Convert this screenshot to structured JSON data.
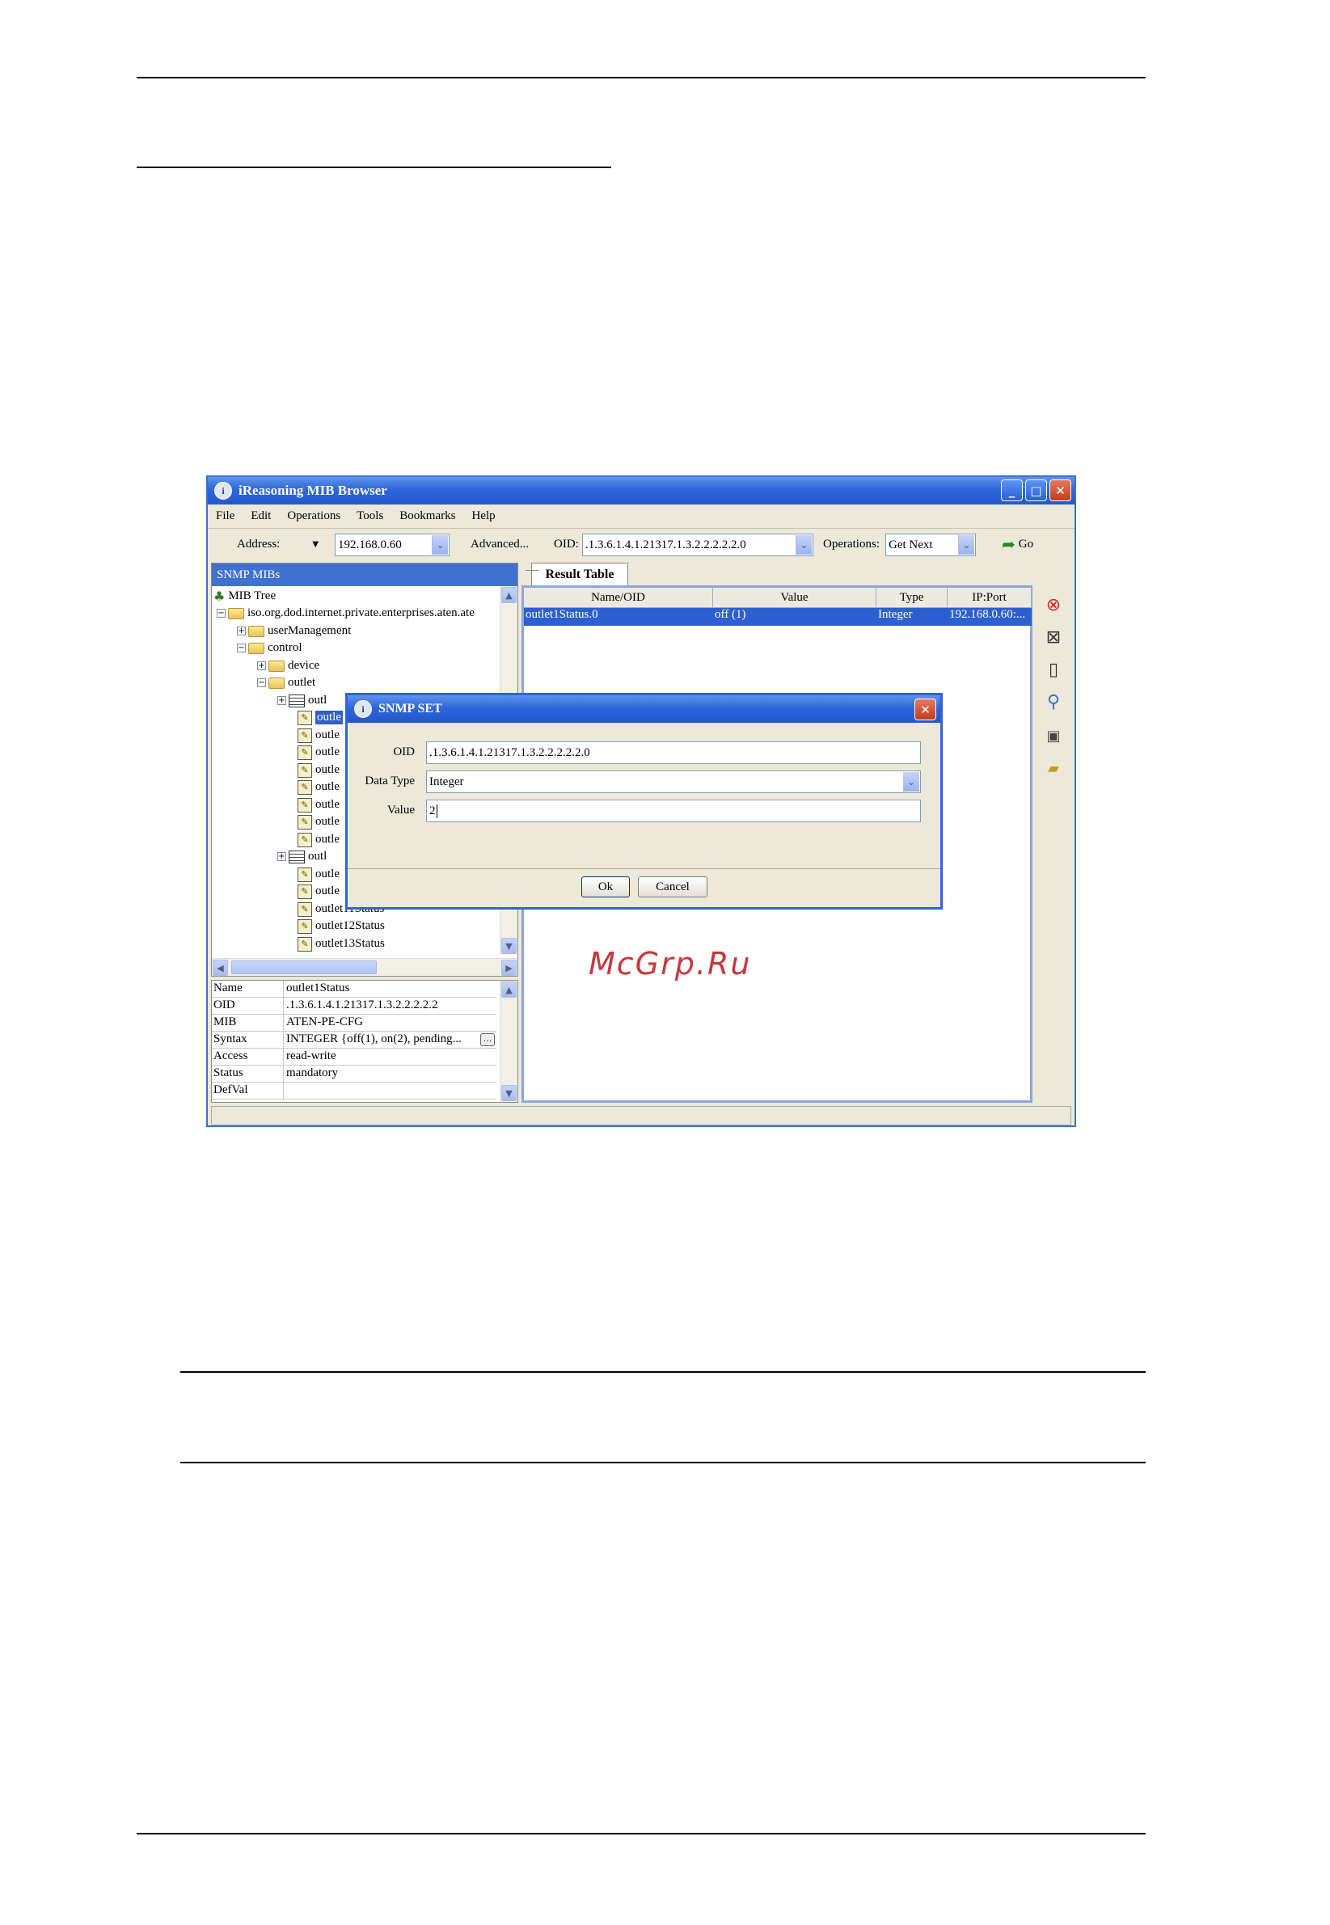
{
  "window": {
    "title": "iReasoning MIB Browser",
    "minimize": "_",
    "maximize": "□",
    "close": "✕"
  },
  "menu": [
    "File",
    "Edit",
    "Operations",
    "Tools",
    "Bookmarks",
    "Help"
  ],
  "toolbar": {
    "address_label": "Address:",
    "address_value": "192.168.0.60",
    "advanced_label": "Advanced...",
    "oid_label": "OID:",
    "oid_value": ".1.3.6.1.4.1.21317.1.3.2.2.2.2.2.0",
    "operations_label": "Operations:",
    "operations_value": "Get Next",
    "go_label": "Go"
  },
  "left_pane": {
    "header": "SNMP MIBs",
    "tree": [
      {
        "label": "MIB Tree",
        "icon": "tree-icon"
      },
      {
        "label": "iso.org.dod.internet.private.enterprises.aten.ate",
        "icon": "folder-icon"
      },
      {
        "label": "userManagement",
        "icon": "folder-icon"
      },
      {
        "label": "control",
        "icon": "folder-icon"
      },
      {
        "label": "device",
        "icon": "folder-icon"
      },
      {
        "label": "outlet",
        "icon": "folder-icon"
      },
      {
        "label": "outl",
        "icon": "table-icon"
      },
      {
        "label": "outle",
        "icon": "leaf-icon"
      },
      {
        "label": "outle",
        "icon": "leaf-icon"
      },
      {
        "label": "outle",
        "icon": "leaf-icon"
      },
      {
        "label": "outle",
        "icon": "leaf-icon"
      },
      {
        "label": "outle",
        "icon": "leaf-icon"
      },
      {
        "label": "outle",
        "icon": "leaf-icon"
      },
      {
        "label": "outle",
        "icon": "leaf-icon"
      },
      {
        "label": "outle",
        "icon": "leaf-icon"
      },
      {
        "label": "outl",
        "icon": "table-icon"
      },
      {
        "label": "outle",
        "icon": "leaf-icon"
      },
      {
        "label": "outle",
        "icon": "leaf-icon"
      },
      {
        "label": "outlet11Status",
        "icon": "leaf-icon"
      },
      {
        "label": "outlet12Status",
        "icon": "leaf-icon"
      },
      {
        "label": "outlet13Status",
        "icon": "leaf-icon"
      }
    ],
    "properties": [
      {
        "key": "Name",
        "value": "outlet1Status"
      },
      {
        "key": "OID",
        "value": ".1.3.6.1.4.1.21317.1.3.2.2.2.2.2"
      },
      {
        "key": "MIB",
        "value": "ATEN-PE-CFG"
      },
      {
        "key": "Syntax",
        "value": "INTEGER {off(1), on(2), pending..."
      },
      {
        "key": "Access",
        "value": "read-write"
      },
      {
        "key": "Status",
        "value": "mandatory"
      },
      {
        "key": "DefVal",
        "value": ""
      }
    ]
  },
  "result_table": {
    "tab": "Result Table",
    "columns": [
      "Name/OID",
      "Value",
      "Type",
      "IP:Port"
    ],
    "rows": [
      [
        "outlet1Status.0",
        "off (1)",
        "Integer",
        "192.168.0.60:..."
      ]
    ]
  },
  "dialog": {
    "title": "SNMP SET",
    "oid_label": "OID",
    "oid_value": ".1.3.6.1.4.1.21317.1.3.2.2.2.2.2.0",
    "type_label": "Data Type",
    "type_value": "Integer",
    "value_label": "Value",
    "value_value": "2",
    "ok_label": "Ok",
    "cancel_label": "Cancel",
    "close": "✕"
  },
  "watermark": "McGrp.Ru"
}
